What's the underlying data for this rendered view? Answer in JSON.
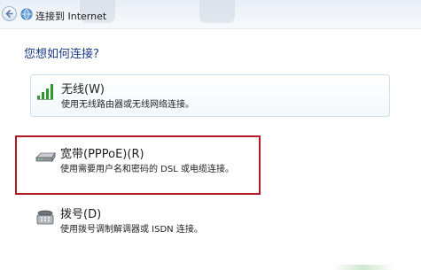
{
  "window": {
    "title": "连接到 Internet"
  },
  "page": {
    "question": "您想如何连接?"
  },
  "options": [
    {
      "icon": "wireless-signal-icon",
      "title": "无线(W)",
      "description": "使用无线路由器或无线网络连接。"
    },
    {
      "icon": "broadband-modem-icon",
      "title": "宽带(PPPoE)(R)",
      "description": "使用需要用户名和密码的 DSL 或电缆连接。"
    },
    {
      "icon": "dialup-modem-icon",
      "title": "拨号(D)",
      "description": "使用拨号调制解调器或 ISDN 连接。"
    }
  ],
  "colors": {
    "heading": "#1b3a86",
    "highlight_box": "#b01822",
    "wireless_signal": "#2e9a2e"
  }
}
